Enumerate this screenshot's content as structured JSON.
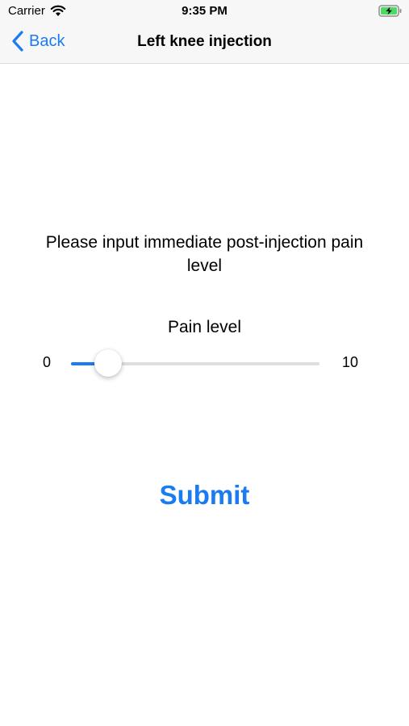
{
  "status_bar": {
    "carrier": "Carrier",
    "time": "9:35 PM",
    "wifi_icon": "wifi-icon",
    "battery_icon": "battery-charging-icon"
  },
  "nav": {
    "back_label": "Back",
    "title": "Left knee injection",
    "back_icon": "chevron-left-icon"
  },
  "form": {
    "prompt": "Please input immediate post-injection pain level",
    "slider": {
      "title": "Pain level",
      "min_label": "0",
      "max_label": "10",
      "min": 0,
      "max": 10,
      "value": 1.5
    },
    "submit_label": "Submit"
  },
  "colors": {
    "accent": "#1a7cf0",
    "track": "#dedede",
    "bar_background": "#f7f7f7"
  }
}
